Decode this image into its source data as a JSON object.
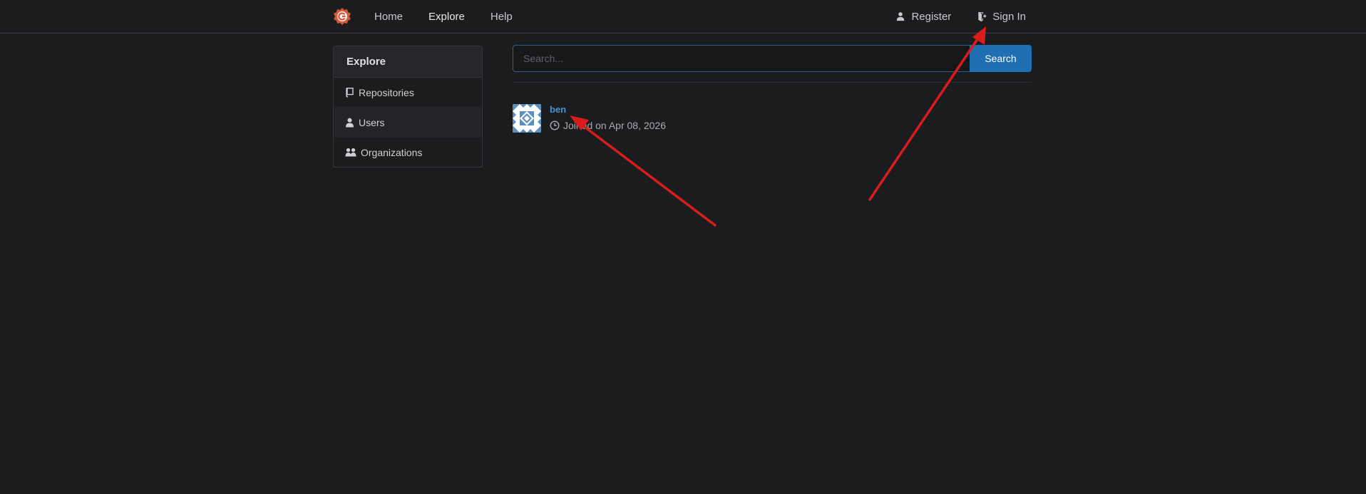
{
  "navbar": {
    "logo": "gitea-logo",
    "links": [
      {
        "label": "Home"
      },
      {
        "label": "Explore",
        "active": true
      },
      {
        "label": "Help"
      }
    ],
    "register_label": "Register",
    "signin_label": "Sign In"
  },
  "sidebar": {
    "title": "Explore",
    "items": [
      {
        "label": "Repositories",
        "icon": "repo-icon"
      },
      {
        "label": "Users",
        "icon": "person-icon",
        "active": true
      },
      {
        "label": "Organizations",
        "icon": "people-icon"
      }
    ]
  },
  "search": {
    "placeholder": "Search...",
    "value": "",
    "button_label": "Search"
  },
  "users": [
    {
      "name": "ben",
      "joined": "Joined on Apr 08, 2026",
      "avatar": "identicon"
    }
  ],
  "colors": {
    "background": "#1b1c1e",
    "primary": "#1f6fb2",
    "link": "#4f8fd1",
    "annotation": "#d91c1c"
  }
}
